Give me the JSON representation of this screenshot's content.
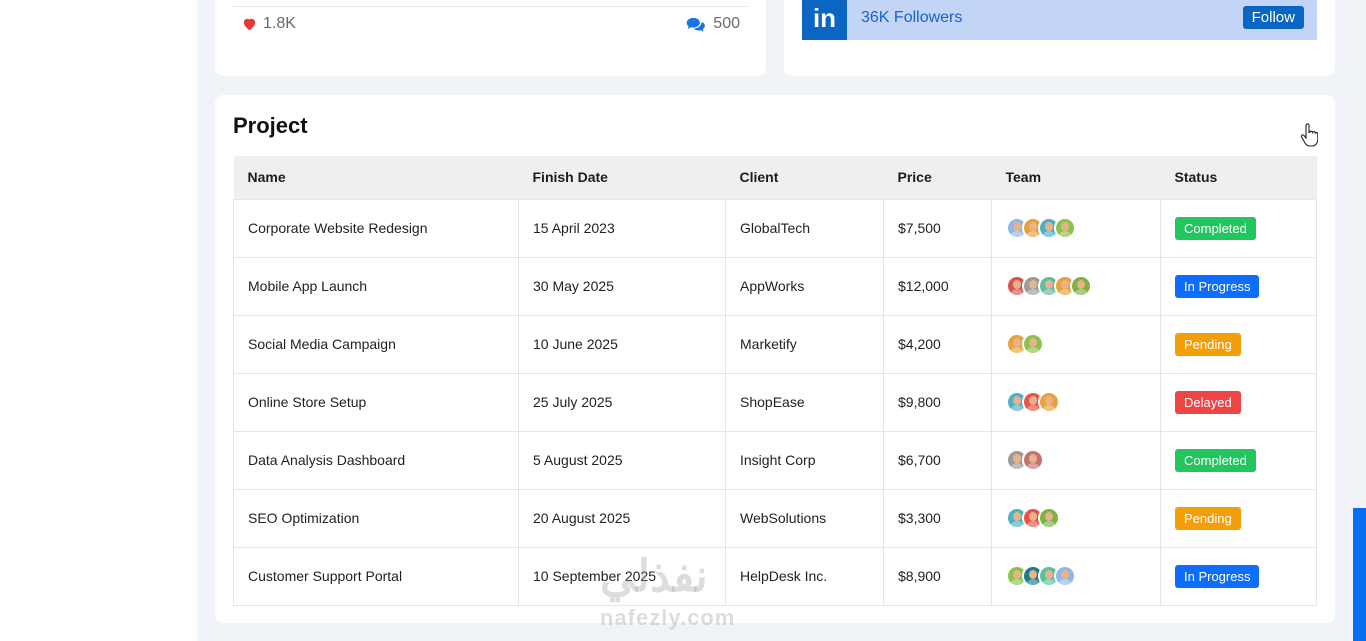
{
  "social": {
    "likes": "1.8K",
    "comments": "500"
  },
  "linkedin": {
    "followers": "36K Followers",
    "follow_label": "Follow",
    "logo_text": "in"
  },
  "project": {
    "title": "Project",
    "columns": [
      "Name",
      "Finish Date",
      "Client",
      "Price",
      "Team",
      "Status"
    ],
    "rows": [
      {
        "name": "Corporate Website Redesign",
        "date": "15 April 2023",
        "client": "GlobalTech",
        "price": "$7,500",
        "team": [
          "#8fb8e8",
          "#e9a23b",
          "#4fb0c6",
          "#8bc34a"
        ],
        "status": "Completed",
        "status_color": "#22c55e"
      },
      {
        "name": "Mobile App Launch",
        "date": "30 May 2025",
        "client": "AppWorks",
        "price": "$12,000",
        "team": [
          "#d9534f",
          "#9b9b9b",
          "#5bc0a0",
          "#e9a23b",
          "#7cb342"
        ],
        "status": "In Progress",
        "status_color": "#0d6efd"
      },
      {
        "name": "Social Media Campaign",
        "date": "10 June 2025",
        "client": "Marketify",
        "price": "$4,200",
        "team": [
          "#e9a23b",
          "#8bc34a"
        ],
        "status": "Pending",
        "status_color": "#f59e0b"
      },
      {
        "name": "Online Store Setup",
        "date": "25 July 2025",
        "client": "ShopEase",
        "price": "$9,800",
        "team": [
          "#4fb0c6",
          "#e8544a",
          "#e9a23b"
        ],
        "status": "Delayed",
        "status_color": "#ef4444"
      },
      {
        "name": "Data Analysis Dashboard",
        "date": "5 August 2025",
        "client": "Insight Corp",
        "price": "$6,700",
        "team": [
          "#9b9b9b",
          "#c77272"
        ],
        "status": "Completed",
        "status_color": "#22c55e"
      },
      {
        "name": "SEO Optimization",
        "date": "20 August 2025",
        "client": "WebSolutions",
        "price": "$3,300",
        "team": [
          "#4fb0c6",
          "#e8544a",
          "#7cb342"
        ],
        "status": "Pending",
        "status_color": "#f59e0b"
      },
      {
        "name": "Customer Support Portal",
        "date": "10 September 2025",
        "client": "HelpDesk Inc.",
        "price": "$8,900",
        "team": [
          "#8bc34a",
          "#1f7a8c",
          "#5bc0a0",
          "#8fb8e8"
        ],
        "status": "In Progress",
        "status_color": "#0d6efd"
      }
    ]
  },
  "watermark": {
    "arabic": "نفذلي",
    "latin": "nafezly.com"
  },
  "colors": {
    "accent": "#0a66c2",
    "heart": "#e53935",
    "comment": "#1a73e8"
  }
}
